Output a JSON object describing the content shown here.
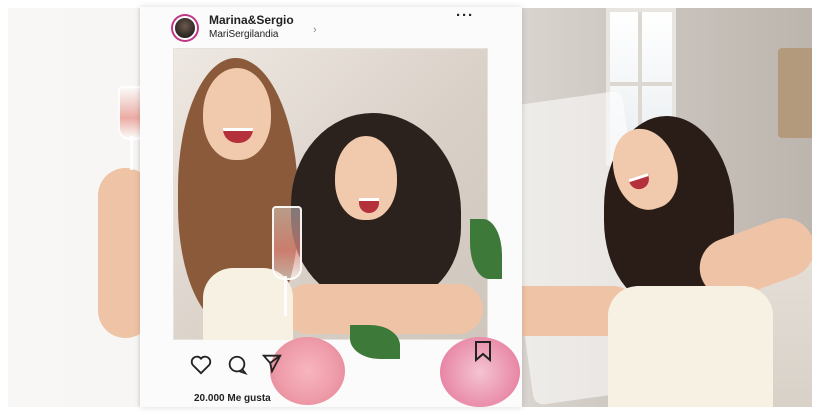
{
  "post": {
    "username": "Marina&Sergio",
    "location": "MariSergilandia",
    "likes": "20.000 Me gusta",
    "more_icon": "···",
    "icons": [
      "heart-icon",
      "comment-icon",
      "send-icon",
      "bookmark-icon"
    ]
  },
  "colors": {
    "frame": "#fbfbfb",
    "dress": "#f7f1e3",
    "flowers_pink": "#ee9aa8"
  }
}
